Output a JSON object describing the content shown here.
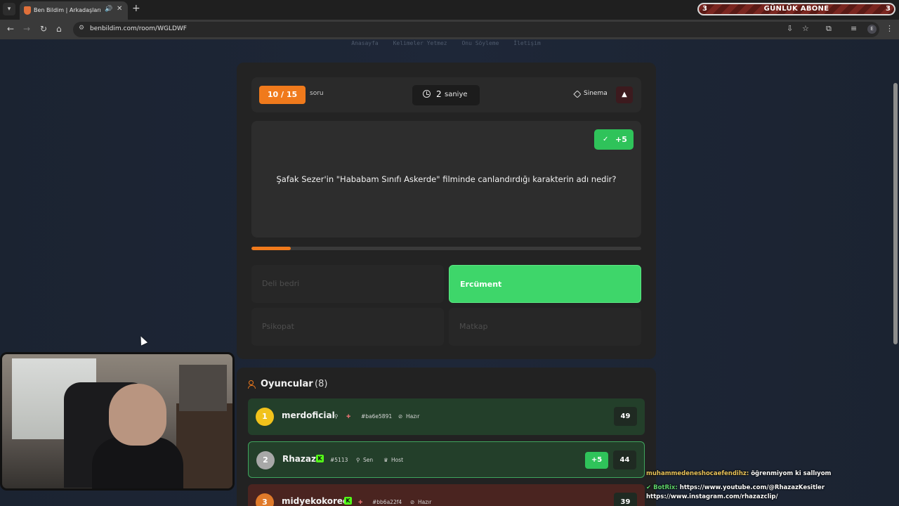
{
  "browser": {
    "tab_title": "Ben Bildim | Arkadaşlarınla Bilgi",
    "url": "benbildim.com/room/WGLDWF",
    "abone_left": "3",
    "abone_label": "GÜNLÜK ABONE",
    "abone_right": "3",
    "profile_letter": "E"
  },
  "topnav": [
    "Anasayfa",
    "Kelimeler Yetmez",
    "Onu Söyleme",
    "İletişim"
  ],
  "quiz": {
    "counter": "10 / 15",
    "counter_suffix": "soru",
    "timer_value": "2",
    "timer_unit": "saniye",
    "category": "Sinema",
    "points": "+5",
    "question": "Şafak Sezer'in \"Hababam Sınıfı Askerde\" filminde canlandırdığı karakterin adı nedir?",
    "progress_fraction": 0.1,
    "answers": [
      "Deli bedri",
      "Ercüment",
      "Psikopat",
      "Matkap"
    ],
    "correct_index": 1
  },
  "players": {
    "title": "Oyuncular",
    "count": "(8)",
    "rows": [
      {
        "rank": "1",
        "name": "merdoficial",
        "id": "#ba6e5891",
        "status": "Hazır",
        "score": "49"
      },
      {
        "rank": "2",
        "name": "Rhazaz",
        "id": "#5113",
        "you": "Sen",
        "host": "Host",
        "gain": "+5",
        "score": "44"
      },
      {
        "rank": "3",
        "name": "midyekokorec",
        "id": "#bb6a22f4",
        "status": "Hazır",
        "score": "39"
      }
    ]
  },
  "chat": {
    "msg1_user": "muhammedeneshocaefendihz:",
    "msg1_text": "öğrenmiyom ki sallıyom",
    "msg2_user": "BotRix:",
    "msg2_text": "https://www.youtube.com/@RhazazKesitler",
    "msg2_text2": "https://www.instagram.com/rhazazclip/"
  },
  "colors": {
    "accent": "#f07a1c",
    "correct": "#3ed66a",
    "gold": "#f1c21b"
  }
}
